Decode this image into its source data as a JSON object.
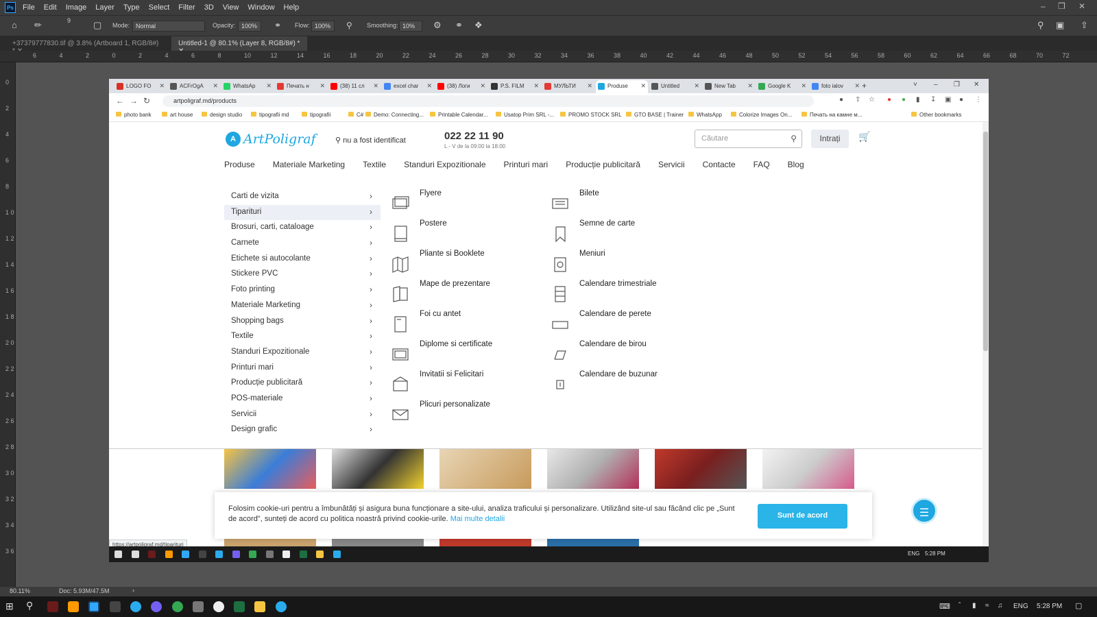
{
  "photoshop": {
    "menu": [
      "File",
      "Edit",
      "Image",
      "Layer",
      "Type",
      "Select",
      "Filter",
      "3D",
      "View",
      "Window",
      "Help"
    ],
    "options": {
      "mode_label": "Mode:",
      "mode_value": "Normal",
      "opacity_label": "Opacity:",
      "opacity_value": "100%",
      "flow_label": "Flow:",
      "flow_value": "100%",
      "smoothing_label": "Smoothing:",
      "smoothing_value": "10%",
      "brush_size": "9"
    },
    "doc_tabs": [
      {
        "label": "+37379777830.tif @ 3.8% (Artboard 1, RGB/8#) *"
      },
      {
        "label": "Untitled-1 @ 80.1% (Layer 8, RGB/8#) *"
      }
    ],
    "ruler_top": [
      "6",
      "4",
      "2",
      "0",
      "2",
      "4",
      "6",
      "8",
      "10",
      "12",
      "14",
      "16",
      "18",
      "20",
      "22",
      "24",
      "26",
      "28",
      "30",
      "32",
      "34",
      "36",
      "38",
      "40",
      "42",
      "44",
      "46",
      "48",
      "50",
      "52",
      "54",
      "56",
      "58",
      "60",
      "62",
      "64",
      "66",
      "68",
      "70",
      "72"
    ],
    "ruler_left": [
      "0",
      "2",
      "4",
      "6",
      "8",
      "1 0",
      "1 2",
      "1 4",
      "1 6",
      "1 8",
      "2 0",
      "2 2",
      "2 4",
      "2 6",
      "2 8",
      "3 0",
      "3 2",
      "3 4",
      "3 6"
    ],
    "status": {
      "zoom": "80.11%",
      "doc": "Doc: 5.93M/47.5M"
    }
  },
  "browser": {
    "tabs": [
      {
        "label": "LOGO FO",
        "color": "#d93025"
      },
      {
        "label": "ACFrOgA",
        "color": "#555555"
      },
      {
        "label": "WhatsAp",
        "color": "#25d366"
      },
      {
        "label": "Печать н",
        "color": "#e53935"
      },
      {
        "label": "(38) 11 сл",
        "color": "#ff0000"
      },
      {
        "label": "excel char",
        "color": "#4285f4"
      },
      {
        "label": "(38) Логи",
        "color": "#ff0000"
      },
      {
        "label": "P.S. FILM",
        "color": "#333333"
      },
      {
        "label": "МУЛЬТИ",
        "color": "#e53935"
      },
      {
        "label": "Produse",
        "color": "#1ea7e1"
      },
      {
        "label": "Untitled",
        "color": "#555555"
      },
      {
        "label": "New Tab",
        "color": "#555555"
      },
      {
        "label": "Google K",
        "color": "#34a853"
      },
      {
        "label": "foto ialov",
        "color": "#4285f4"
      }
    ],
    "url": "artpoligraf.md/products",
    "bookmarks": [
      "photo bank",
      "art house",
      "design studio",
      "tipografii md",
      "tipografii",
      "C#",
      "Demo: Connecting...",
      "Printable Calendar...",
      "Usatop Prim SRL -...",
      "PROMO STOCK SRL",
      "GTO BASE | Trainer",
      "WhatsApp",
      "Colorize Images On...",
      "Печать на камне м...",
      "Other bookmarks"
    ],
    "status_url": "https://artpoligraf.md/tiparituri"
  },
  "site": {
    "logo": "ArtPoligraf",
    "location": "nu a fost identificat",
    "phone": "022 22 11 90",
    "hours": "L - V de la 09:00 la 18:00",
    "search_placeholder": "Căutare",
    "login": "Intrați",
    "nav": [
      "Produse",
      "Materiale Marketing",
      "Textile",
      "Standuri Expozitionale",
      "Printuri mari",
      "Producție publicitară",
      "Servicii",
      "Contacte",
      "FAQ",
      "Blog"
    ],
    "categories": [
      "Carti de vizita",
      "Tiparituri",
      "Brosuri, carti, cataloage",
      "Carnete",
      "Etichete si autocolante",
      "Stickere PVC",
      "Foto printing",
      "Materiale Marketing",
      "Shopping bags",
      "Textile",
      "Standuri Expozitionale",
      "Printuri mari",
      "Producție publicitară",
      "POS-materiale",
      "Servicii",
      "Design grafic"
    ],
    "active_category": "Tiparituri",
    "sub_col1": [
      {
        "label": "Flyere",
        "icon": "flyer-icon"
      },
      {
        "label": "Postere",
        "icon": "poster-icon"
      },
      {
        "label": "Pliante si Booklete",
        "icon": "leaflet-icon"
      },
      {
        "label": "Mape de prezentare",
        "icon": "folder-icon"
      },
      {
        "label": "Foi cu antet",
        "icon": "letterhead-icon"
      },
      {
        "label": "Diplome si certificate",
        "icon": "diploma-icon"
      },
      {
        "label": "Invitatii si Felicitari",
        "icon": "invitation-icon"
      },
      {
        "label": "Plicuri personalizate",
        "icon": "envelope-icon"
      }
    ],
    "sub_col2": [
      {
        "label": "Bilete",
        "icon": "ticket-icon"
      },
      {
        "label": "Semne de carte",
        "icon": "bookmark-icon"
      },
      {
        "label": "Meniuri",
        "icon": "menu-card-icon"
      },
      {
        "label": "Calendare trimestriale",
        "icon": "quarterly-calendar-icon"
      },
      {
        "label": "Calendare de perete",
        "icon": "wall-calendar-icon"
      },
      {
        "label": "Calendare de birou",
        "icon": "desk-calendar-icon"
      },
      {
        "label": "Calendare de buzunar",
        "icon": "pocket-calendar-icon"
      }
    ],
    "cookie_text": "Folosim cookie-uri pentru a îmbunătăți și asigura buna funcționare a site-ului, analiza traficului și personalizare. Utilizând site-ul sau făcând clic pe „Sunt de acord\", sunteți de acord cu politica noastră privind cookie-urile. ",
    "cookie_link": "Mai multe detalii",
    "cookie_button": "Sunt de acord"
  },
  "taskbar": {
    "lang": "ENG",
    "time": "5:28 PM"
  },
  "colors": {
    "accent": "#1ea7e1",
    "ps_bg": "#535353",
    "menu_active": "#eceff6"
  }
}
